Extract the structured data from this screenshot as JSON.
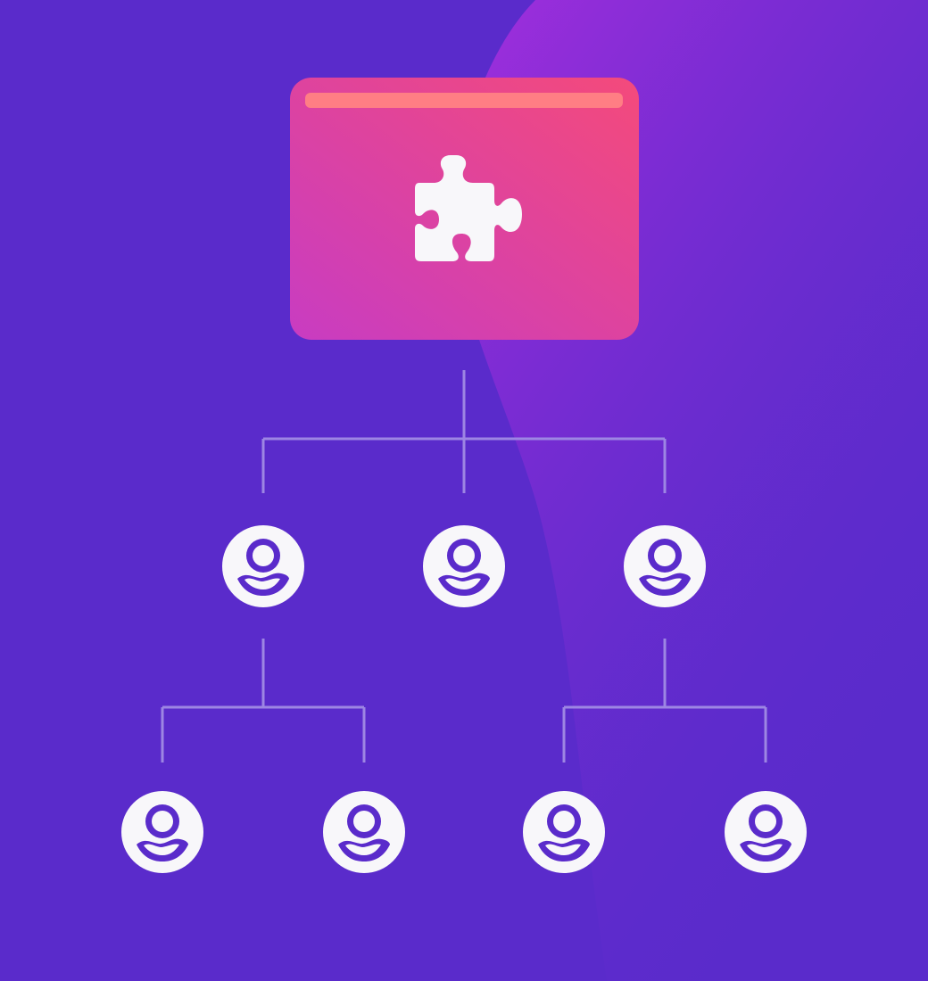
{
  "colors": {
    "background": "#5A2BCB",
    "background_glow": "#A32EDD",
    "card_gradient_start": "#C83CC2",
    "card_gradient_end": "#F44A7B",
    "card_bar": "#FF7E84",
    "icon_fill": "#F8F7FA",
    "connector": "#9D86E3"
  },
  "diagram": {
    "root": {
      "icon": "puzzle-piece-icon"
    },
    "children": [
      {
        "icon": "user-avatar-icon",
        "children": [
          {
            "icon": "user-avatar-icon"
          },
          {
            "icon": "user-avatar-icon"
          }
        ]
      },
      {
        "icon": "user-avatar-icon",
        "children": []
      },
      {
        "icon": "user-avatar-icon",
        "children": [
          {
            "icon": "user-avatar-icon"
          },
          {
            "icon": "user-avatar-icon"
          }
        ]
      }
    ]
  }
}
